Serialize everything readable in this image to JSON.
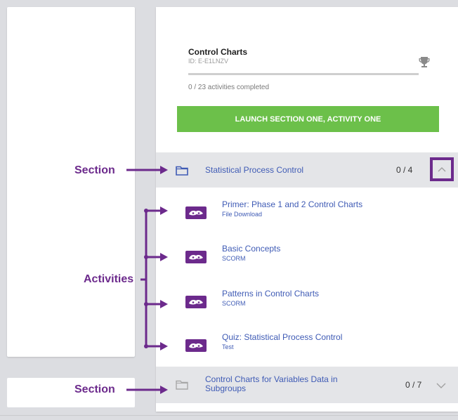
{
  "course": {
    "title": "Control Charts",
    "id": "ID: E-E1LNZV",
    "progress_text": "0 / 23 activities completed",
    "progress_fraction": 0,
    "trophy_icon": "trophy-icon",
    "launch_label": "LAUNCH SECTION ONE, ACTIVITY ONE"
  },
  "sections": [
    {
      "title": "Statistical Process Control",
      "count": "0 / 4",
      "expanded": true,
      "icon": "folder-icon",
      "activities": [
        {
          "title": "Primer: Phase 1 and 2 Control Charts",
          "type": "File Download",
          "icon": "activity-icon"
        },
        {
          "title": "Basic Concepts",
          "type": "SCORM",
          "icon": "activity-icon"
        },
        {
          "title": "Patterns in Control Charts",
          "type": "SCORM",
          "icon": "activity-icon"
        },
        {
          "title": "Quiz: Statistical Process Control",
          "type": "Test",
          "icon": "activity-icon"
        }
      ]
    },
    {
      "title_line1": "Control Charts for Variables Data in",
      "title_line2": "Subgroups",
      "count": "0 / 7",
      "expanded": false,
      "icon": "folder-icon"
    }
  ],
  "annotations": {
    "section_label": "Section",
    "activities_label": "Activities",
    "section_label_2": "Section"
  },
  "colors": {
    "accent": "#3f5bb5",
    "launch": "#6cc04a",
    "annotation": "#6c2a8c"
  }
}
